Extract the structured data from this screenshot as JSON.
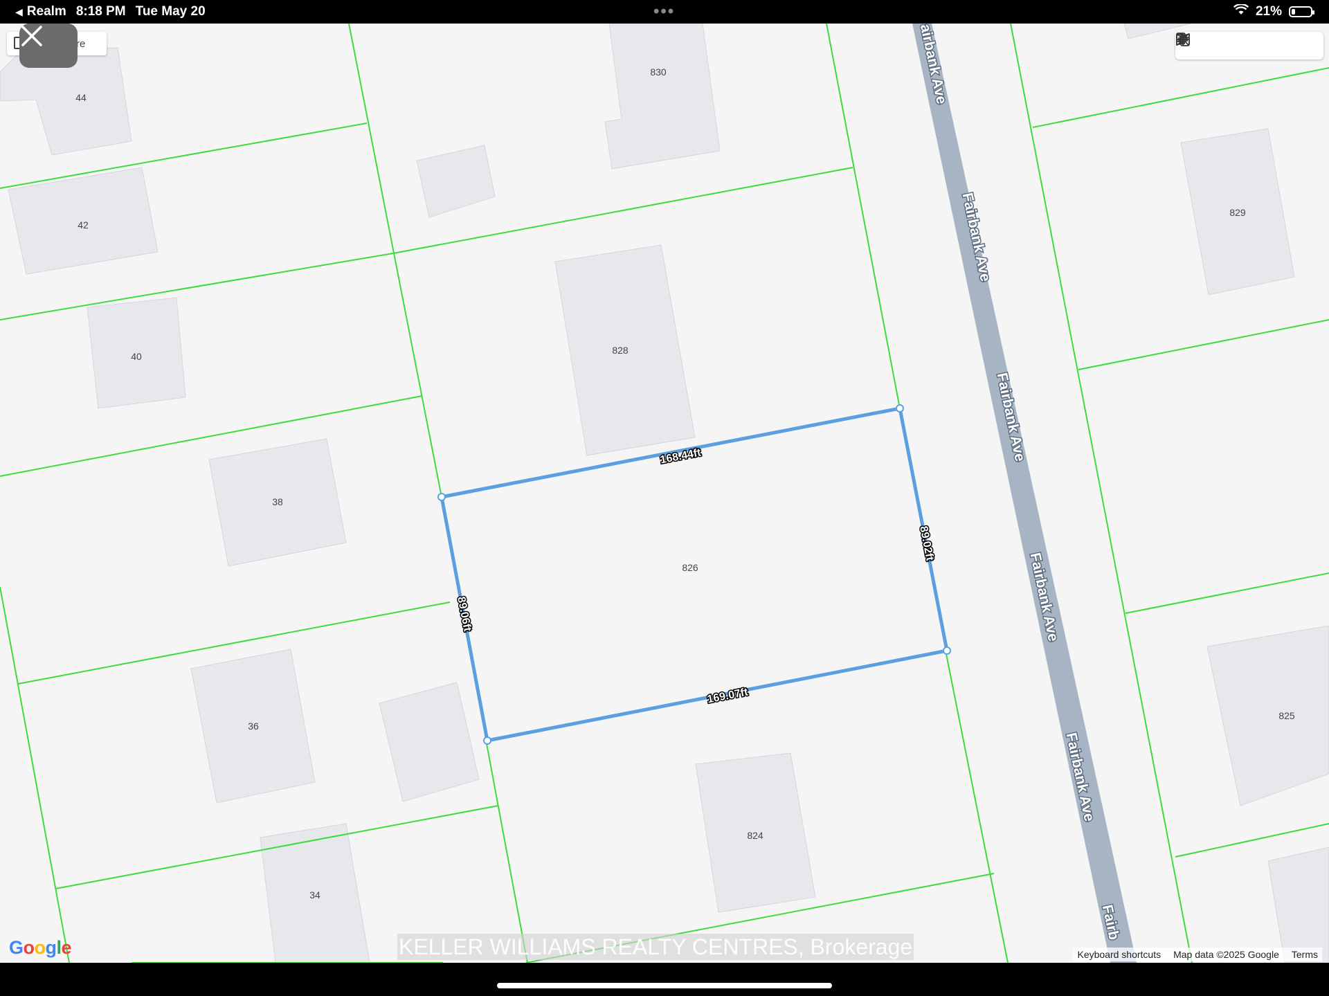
{
  "status_bar": {
    "back_app": "Realm",
    "time": "8:18 PM",
    "date": "Tue May 20",
    "battery": "21%",
    "battery_level": 0.21
  },
  "map": {
    "menu_label": "re",
    "street_name": "Fairbank Ave",
    "street_name_partial_top": "airbank Ave",
    "street_name_partial_bottom": "Fairb",
    "buildings": [
      "44",
      "42",
      "40",
      "38",
      "36",
      "34",
      "830",
      "828",
      "826",
      "824",
      "829",
      "825"
    ],
    "dimensions": {
      "top": "168.44ft",
      "right": "89.02ft",
      "bottom": "169.07ft",
      "left": "89.06ft"
    },
    "colors": {
      "parcel_line": "#3cdc3c",
      "selection": "#5b9fe0",
      "road": "#a6b4c4",
      "building": "#e6e8ec",
      "background": "#f5f5f5"
    }
  },
  "toolbar": {
    "icons": [
      "map-layers-icon",
      "copy-icon",
      "zoom-in-icon",
      "zoom-out-icon",
      "collapse-icon"
    ]
  },
  "attribution": {
    "logo": "Google",
    "watermark": "KELLER WILLIAMS REALTY CENTRES, Brokerage",
    "keyboard_shortcuts": "Keyboard shortcuts",
    "map_data": "Map data ©2025 Google",
    "terms": "Terms"
  }
}
